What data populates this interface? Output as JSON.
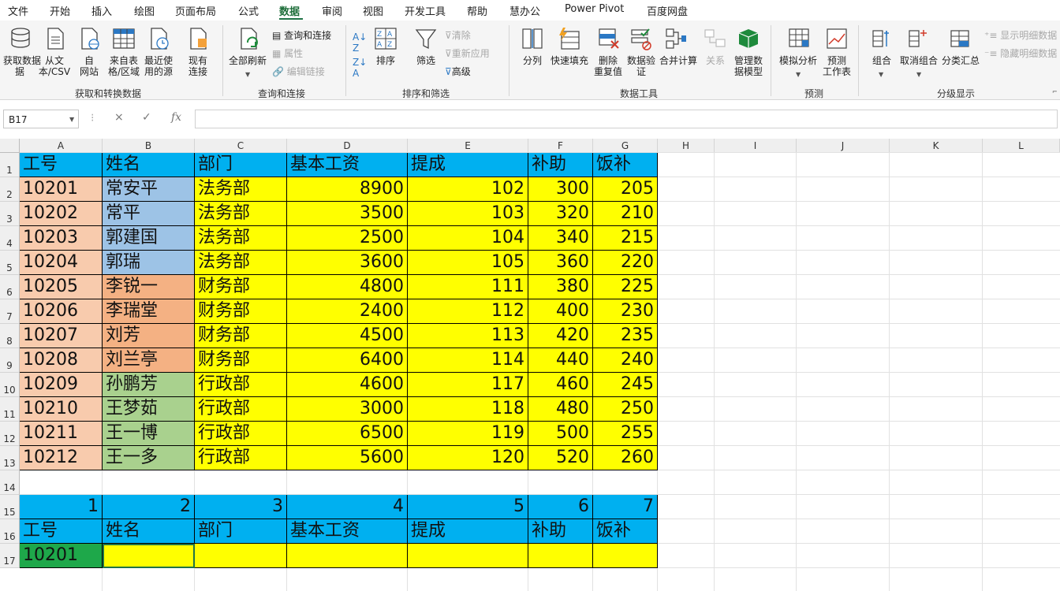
{
  "menu": [
    "文件",
    "开始",
    "插入",
    "绘图",
    "页面布局",
    "公式",
    "数据",
    "审阅",
    "视图",
    "开发工具",
    "帮助",
    "慧办公",
    "Power Pivot",
    "百度网盘"
  ],
  "ribbon": {
    "get_data": "获取数据",
    "get_data_line2": "据",
    "from_text": "从文",
    "from_text_line2": "本/CSV",
    "from_web": "自",
    "from_web_line2": "网站",
    "from_table": "来自表",
    "from_table_line2": "格/区域",
    "recent_sources": "最近使",
    "recent_sources_line2": "用的源",
    "existing": "现有",
    "existing_line2": "连接",
    "group_get": "获取和转换数据",
    "refresh_all": "全部刷新",
    "queries": "查询和连接",
    "properties": "属性",
    "edit_links": "编辑链接",
    "group_query": "查询和连接",
    "sort": "排序",
    "filter": "筛选",
    "clear": "清除",
    "reapply": "重新应用",
    "advanced": "高级",
    "group_sort": "排序和筛选",
    "text_to_columns": "分列",
    "flash_fill": "快速填充",
    "remove_dup": "删除",
    "remove_dup_line2": "重复值",
    "validation": "数据验",
    "validation_line2": "证",
    "consolidate": "合并计算",
    "relations": "关系",
    "manage_model": "管理数",
    "manage_model_line2": "据模型",
    "group_tools": "数据工具",
    "whatif": "模拟分析",
    "forecast": "预测",
    "forecast_line2": "工作表",
    "group_forecast": "预测",
    "group_btn": "组合",
    "ungroup": "取消组合",
    "subtotal": "分类汇总",
    "show_detail": "显示明细数据",
    "hide_detail": "隐藏明细数据",
    "group_outline": "分级显示"
  },
  "formula_bar": {
    "name_box": "B17",
    "fx": "fx",
    "cancel": "×",
    "enter": "✓",
    "formula": ""
  },
  "columns": [
    "A",
    "B",
    "C",
    "D",
    "E",
    "F",
    "G",
    "H",
    "I",
    "J",
    "K",
    "L"
  ],
  "rows": [
    "1",
    "2",
    "3",
    "4",
    "5",
    "6",
    "7",
    "8",
    "9",
    "10",
    "11",
    "12",
    "13",
    "14",
    "15",
    "16",
    "17"
  ],
  "headers": [
    "工号",
    "姓名",
    "部门",
    "基本工资",
    "提成",
    "补助",
    "饭补"
  ],
  "table": [
    [
      "10201",
      "常安平",
      "法务部",
      "8900",
      "102",
      "300",
      "205"
    ],
    [
      "10202",
      "常平",
      "法务部",
      "3500",
      "103",
      "320",
      "210"
    ],
    [
      "10203",
      "郭建国",
      "法务部",
      "2500",
      "104",
      "340",
      "215"
    ],
    [
      "10204",
      "郭瑞",
      "法务部",
      "3600",
      "105",
      "360",
      "220"
    ],
    [
      "10205",
      "李锐一",
      "财务部",
      "4800",
      "111",
      "380",
      "225"
    ],
    [
      "10206",
      "李瑞堂",
      "财务部",
      "2400",
      "112",
      "400",
      "230"
    ],
    [
      "10207",
      "刘芳",
      "财务部",
      "4500",
      "113",
      "420",
      "235"
    ],
    [
      "10208",
      "刘兰亭",
      "财务部",
      "6400",
      "114",
      "440",
      "240"
    ],
    [
      "10209",
      "孙鹏芳",
      "行政部",
      "4600",
      "117",
      "460",
      "245"
    ],
    [
      "10210",
      "王梦茹",
      "行政部",
      "3000",
      "118",
      "480",
      "250"
    ],
    [
      "10211",
      "王一博",
      "行政部",
      "6500",
      "119",
      "500",
      "255"
    ],
    [
      "10212",
      "王一多",
      "行政部",
      "5600",
      "120",
      "520",
      "260"
    ]
  ],
  "index_row": [
    "1",
    "2",
    "3",
    "4",
    "5",
    "6",
    "7"
  ],
  "lookup_headers": [
    "工号",
    "姓名",
    "部门",
    "基本工资",
    "提成",
    "补助",
    "饭补"
  ],
  "lookup_row": [
    "10201",
    "",
    "",
    "",
    "",
    "",
    ""
  ],
  "colors": {
    "header_blue": "#00b0f0",
    "id_peach": "#f8cbad",
    "name_blue": "#9dc3e6",
    "name_orange": "#f4b183",
    "name_green": "#a9d18e",
    "yellow": "#ffff00",
    "lookup_green": "#1ea84a",
    "excel_green": "#217346"
  }
}
